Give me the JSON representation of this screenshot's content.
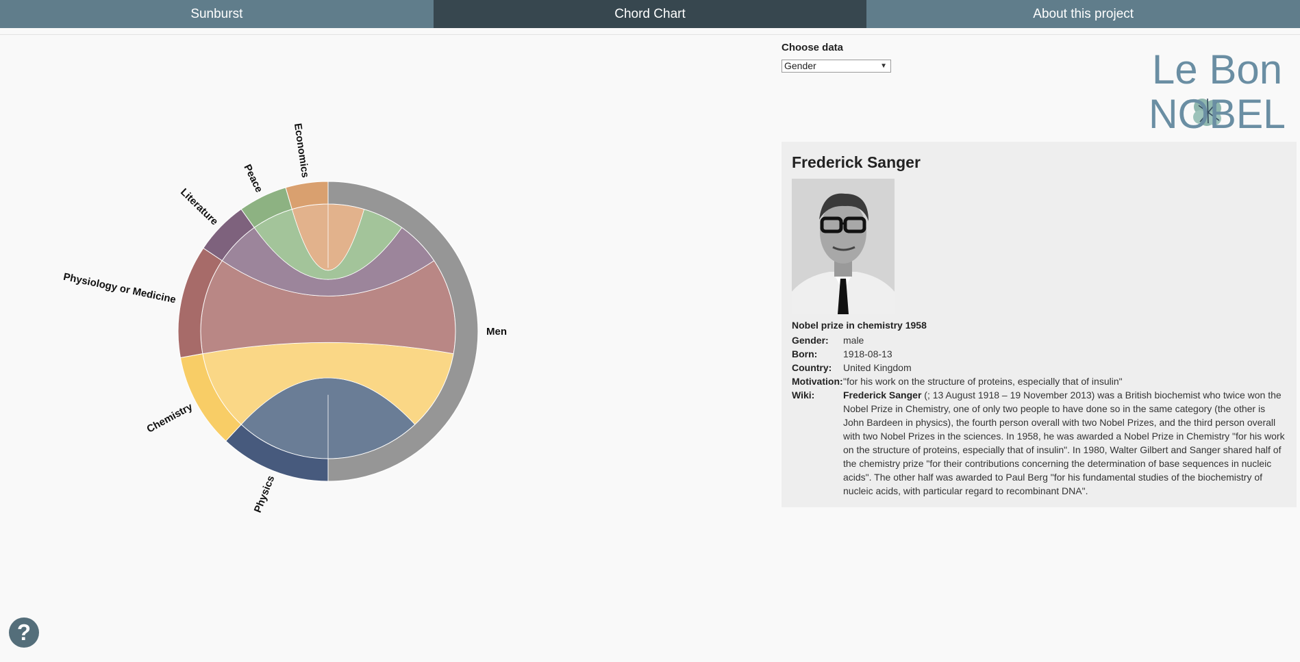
{
  "nav": {
    "tabs": [
      {
        "label": "Sunburst",
        "active": false
      },
      {
        "label": "Chord Chart",
        "active": true
      },
      {
        "label": "About this project",
        "active": false
      }
    ]
  },
  "chooser": {
    "label": "Choose data",
    "selected": "Gender"
  },
  "logo": {
    "line1": "Le Bon",
    "line2": "NOBEL"
  },
  "chart_data": {
    "type": "chord",
    "groups": [
      {
        "name": "Men",
        "color": "#969696"
      },
      {
        "name": "Physics",
        "color": "#475a7d"
      },
      {
        "name": "Chemistry",
        "color": "#f8cd66"
      },
      {
        "name": "Physiology or Medicine",
        "color": "#a76b69"
      },
      {
        "name": "Literature",
        "color": "#7e627d"
      },
      {
        "name": "Peace",
        "color": "#8db282"
      },
      {
        "name": "Economics",
        "color": "#d9a06f"
      }
    ],
    "ribbon_colors": {
      "Physics": "#6a7d96",
      "Chemistry": "#fad786",
      "Physiology or Medicine": "#b98785",
      "Literature": "#9c859b",
      "Peace": "#a3c49a",
      "Economics": "#e2b28c"
    },
    "values": {
      "Physics": 204,
      "Chemistry": 175,
      "Physiology or Medicine": 208,
      "Literature": 99,
      "Peace": 90,
      "Economics": 78
    }
  },
  "laureate": {
    "name": "Frederick Sanger",
    "prize": "Nobel prize in chemistry 1958",
    "gender_label": "Gender:",
    "gender": "male",
    "born_label": "Born:",
    "born": "1918-08-13",
    "country_label": "Country:",
    "country": "United Kingdom",
    "motivation_label": "Motivation:",
    "motivation": "\"for his work on the structure of proteins, especially that of insulin\"",
    "wiki_label": "Wiki:",
    "wiki_bold": "Frederick Sanger",
    "wiki_text": " (; 13 August 1918 – 19 November 2013) was a British biochemist who twice won the Nobel Prize in Chemistry, one of only two people to have done so in the same category (the other is John Bardeen in physics), the fourth person overall with two Nobel Prizes, and the third person overall with two Nobel Prizes in the sciences. In 1958, he was awarded a Nobel Prize in Chemistry \"for his work on the structure of proteins, especially that of insulin\". In 1980, Walter Gilbert and Sanger shared half of the chemistry prize \"for their contributions concerning the determination of base sequences in nucleic acids\". The other half was awarded to Paul Berg \"for his fundamental studies of the biochemistry of nucleic acids, with particular regard to recombinant DNA\"."
  },
  "help": {
    "label": "?"
  }
}
